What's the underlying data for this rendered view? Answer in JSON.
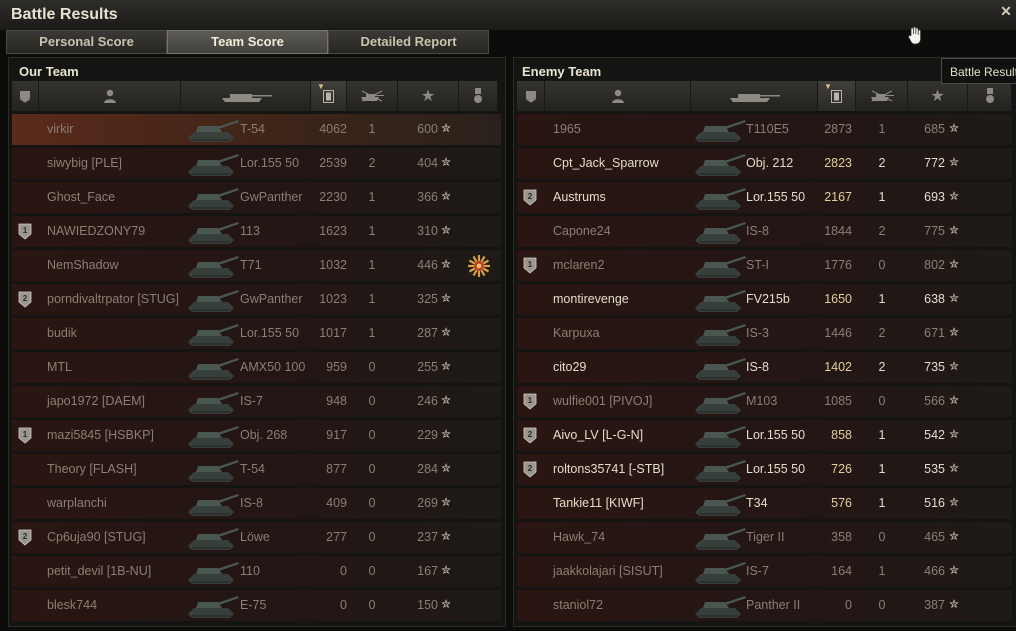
{
  "window": {
    "title": "Battle Results",
    "close_glyph": "✕"
  },
  "tabs": [
    {
      "label": "Personal Score",
      "active": false
    },
    {
      "label": "Team Score",
      "active": true
    },
    {
      "label": "Detailed Report",
      "active": false
    }
  ],
  "tooltip": "Battle Results",
  "our_team": {
    "title": "Our Team",
    "columns": [
      "medal-icon",
      "player-icon",
      "vehicle-icon",
      "damage-icon",
      "kills-icon",
      "xp-star-icon",
      "achievement-icon"
    ],
    "rows": [
      {
        "name": "virkir",
        "vehicle": "T-54",
        "damage": "4062",
        "kills": "1",
        "xp": "600",
        "status": "dead",
        "highlight": true,
        "medal": "",
        "achievement": ""
      },
      {
        "name": "siwybig [PLE]",
        "vehicle": "Lor.155 50",
        "damage": "2539",
        "kills": "2",
        "xp": "404",
        "status": "dead",
        "highlight": false,
        "medal": "",
        "achievement": ""
      },
      {
        "name": "Ghost_Face",
        "vehicle": "GwPanther",
        "damage": "2230",
        "kills": "1",
        "xp": "366",
        "status": "dead",
        "highlight": false,
        "medal": "",
        "achievement": ""
      },
      {
        "name": "NAWIEDZONY79",
        "vehicle": "113",
        "damage": "1623",
        "kills": "1",
        "xp": "310",
        "status": "dead",
        "highlight": false,
        "medal": "1",
        "achievement": ""
      },
      {
        "name": "NemShadow",
        "vehicle": "T71",
        "damage": "1032",
        "kills": "1",
        "xp": "446",
        "status": "dead",
        "highlight": false,
        "medal": "",
        "achievement": "order-medal"
      },
      {
        "name": "porndivaltrpator [STUG]",
        "vehicle": "GwPanther",
        "damage": "1023",
        "kills": "1",
        "xp": "325",
        "status": "dead",
        "highlight": false,
        "medal": "2",
        "achievement": ""
      },
      {
        "name": "budik",
        "vehicle": "Lor.155 50",
        "damage": "1017",
        "kills": "1",
        "xp": "287",
        "status": "dead",
        "highlight": false,
        "medal": "",
        "achievement": ""
      },
      {
        "name": "MTL",
        "vehicle": "AMX50 100",
        "damage": "959",
        "kills": "0",
        "xp": "255",
        "status": "dead",
        "highlight": false,
        "medal": "",
        "achievement": ""
      },
      {
        "name": "japo1972 [DAEM]",
        "vehicle": "IS-7",
        "damage": "948",
        "kills": "0",
        "xp": "246",
        "status": "dead",
        "highlight": false,
        "medal": "",
        "achievement": ""
      },
      {
        "name": "mazi5845 [HSBKP]",
        "vehicle": "Obj. 268",
        "damage": "917",
        "kills": "0",
        "xp": "229",
        "status": "dead",
        "highlight": false,
        "medal": "1",
        "achievement": ""
      },
      {
        "name": "Theory [FLASH]",
        "vehicle": "T-54",
        "damage": "877",
        "kills": "0",
        "xp": "284",
        "status": "dead",
        "highlight": false,
        "medal": "",
        "achievement": ""
      },
      {
        "name": "warplanchi",
        "vehicle": "IS-8",
        "damage": "409",
        "kills": "0",
        "xp": "269",
        "status": "dead",
        "highlight": false,
        "medal": "",
        "achievement": ""
      },
      {
        "name": "Cp6uja90 [STUG]",
        "vehicle": "Löwe",
        "damage": "277",
        "kills": "0",
        "xp": "237",
        "status": "dead",
        "highlight": false,
        "medal": "2",
        "achievement": ""
      },
      {
        "name": "petit_devil [1B-NU]",
        "vehicle": "110",
        "damage": "0",
        "kills": "0",
        "xp": "167",
        "status": "dead",
        "highlight": false,
        "medal": "",
        "achievement": ""
      },
      {
        "name": "blesk744",
        "vehicle": "E-75",
        "damage": "0",
        "kills": "0",
        "xp": "150",
        "status": "dead",
        "highlight": false,
        "medal": "",
        "achievement": ""
      }
    ]
  },
  "enemy_team": {
    "title": "Enemy Team",
    "columns": [
      "medal-icon",
      "player-icon",
      "vehicle-icon",
      "damage-icon",
      "kills-icon",
      "xp-star-icon",
      "achievement-icon"
    ],
    "rows": [
      {
        "name": "1965",
        "vehicle": "T110E5",
        "damage": "2873",
        "kills": "1",
        "xp": "685",
        "status": "dead",
        "medal": ""
      },
      {
        "name": "Cpt_Jack_Sparrow",
        "vehicle": "Obj. 212",
        "damage": "2823",
        "kills": "2",
        "xp": "772",
        "status": "alive",
        "medal": ""
      },
      {
        "name": "Austrums",
        "vehicle": "Lor.155 50",
        "damage": "2167",
        "kills": "1",
        "xp": "693",
        "status": "alive",
        "medal": "2"
      },
      {
        "name": "Capone24",
        "vehicle": "IS-8",
        "damage": "1844",
        "kills": "2",
        "xp": "775",
        "status": "dead",
        "medal": ""
      },
      {
        "name": "mclaren2",
        "vehicle": "ST-I",
        "damage": "1776",
        "kills": "0",
        "xp": "802",
        "status": "dead",
        "medal": "1"
      },
      {
        "name": "montirevenge",
        "vehicle": "FV215b",
        "damage": "1650",
        "kills": "1",
        "xp": "638",
        "status": "alive",
        "medal": ""
      },
      {
        "name": "Karpuxa",
        "vehicle": "IS-3",
        "damage": "1446",
        "kills": "2",
        "xp": "671",
        "status": "dead",
        "medal": ""
      },
      {
        "name": "cito29",
        "vehicle": "IS-8",
        "damage": "1402",
        "kills": "2",
        "xp": "735",
        "status": "alive",
        "medal": ""
      },
      {
        "name": "wulfie001 [PIVOJ]",
        "vehicle": "M103",
        "damage": "1085",
        "kills": "0",
        "xp": "566",
        "status": "dead",
        "medal": "1"
      },
      {
        "name": "Aivo_LV [L-G-N]",
        "vehicle": "Lor.155 50",
        "damage": "858",
        "kills": "1",
        "xp": "542",
        "status": "alive",
        "medal": "2"
      },
      {
        "name": "roltons35741 [-STB]",
        "vehicle": "Lor.155 50",
        "damage": "726",
        "kills": "1",
        "xp": "535",
        "status": "alive",
        "medal": "2"
      },
      {
        "name": "Tankie11 [KIWF]",
        "vehicle": "T34",
        "damage": "576",
        "kills": "1",
        "xp": "516",
        "status": "alive",
        "medal": ""
      },
      {
        "name": "Hawk_74",
        "vehicle": "Tiger II",
        "damage": "358",
        "kills": "0",
        "xp": "465",
        "status": "dead",
        "medal": ""
      },
      {
        "name": "jaakkolajari [SISUT]",
        "vehicle": "IS-7",
        "damage": "164",
        "kills": "1",
        "xp": "466",
        "status": "dead",
        "medal": ""
      },
      {
        "name": "staniol72",
        "vehicle": "Panther II",
        "damage": "0",
        "kills": "0",
        "xp": "387",
        "status": "dead",
        "medal": ""
      }
    ]
  },
  "colors": {
    "accent": "#d7c27a",
    "alive_text": "#e4ddc8",
    "dead_text": "#8a7f73",
    "highlight_row": "#5a2a1a"
  }
}
